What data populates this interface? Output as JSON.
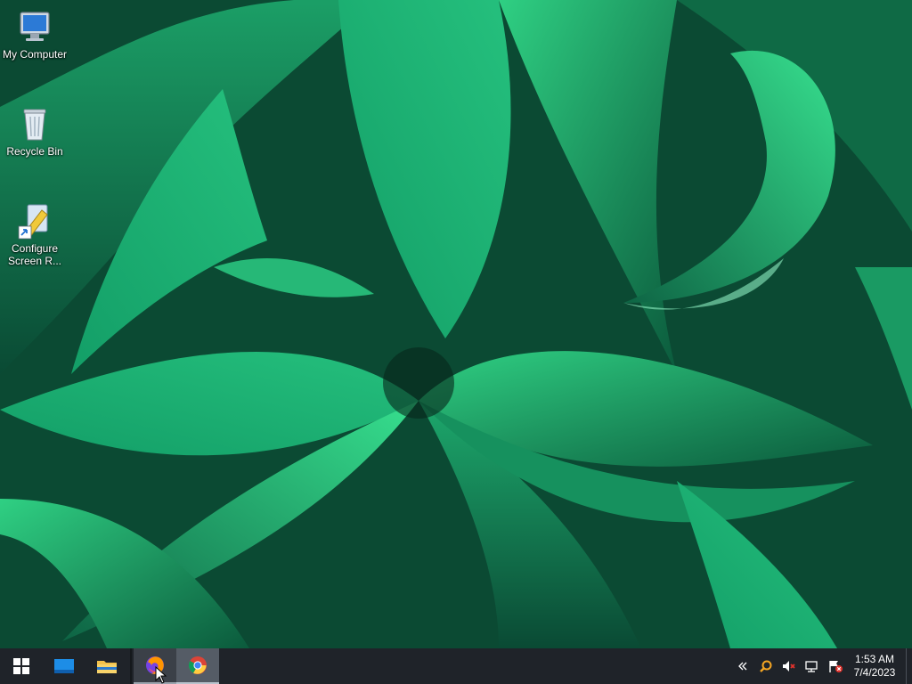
{
  "desktop": {
    "icons": [
      {
        "name": "my-computer",
        "label": "My Computer",
        "icon": "computer-icon"
      },
      {
        "name": "recycle-bin",
        "label": "Recycle Bin",
        "icon": "recycle-bin-icon"
      },
      {
        "name": "configure-screen",
        "label": "Configure Screen R...",
        "icon": "shortcut-ruler-icon"
      }
    ]
  },
  "taskbar": {
    "start_icon": "windows-logo-icon",
    "pinned": [
      {
        "name": "desktop-app",
        "icon": "blue-window-icon",
        "state": "pinned"
      },
      {
        "name": "file-explorer",
        "icon": "folder-icon",
        "state": "pinned"
      },
      {
        "name": "firefox",
        "icon": "firefox-icon",
        "state": "running"
      },
      {
        "name": "chrome",
        "icon": "chrome-icon",
        "state": "active"
      }
    ],
    "tray": {
      "icons": [
        "chevron-left-icon",
        "search-icon",
        "volume-muted-icon",
        "network-disconnected-icon",
        "flag-error-icon"
      ],
      "time": "1:53 AM",
      "date": "7/4/2023"
    }
  },
  "colors": {
    "taskbar_bg": "#1f2329",
    "wallpaper_leaf_dark": "#0a4a34",
    "wallpaper_leaf_light": "#2fc77a"
  }
}
